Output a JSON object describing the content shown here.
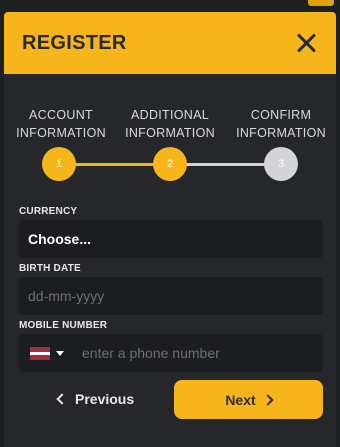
{
  "modal": {
    "title": "REGISTER",
    "close_icon": "close-icon"
  },
  "steps": [
    {
      "label_line1": "ACCOUNT",
      "label_line2": "INFORMATION",
      "number": "1",
      "state": "completed"
    },
    {
      "label_line1": "ADDITIONAL",
      "label_line2": "INFORMATION",
      "number": "2",
      "state": "current"
    },
    {
      "label_line1": "CONFIRM",
      "label_line2": "INFORMATION",
      "number": "3",
      "state": "upcoming"
    }
  ],
  "form": {
    "currency": {
      "label": "CURRENCY",
      "value": "Choose..."
    },
    "birth_date": {
      "label": "BIRTH DATE",
      "placeholder": "dd-mm-yyyy"
    },
    "mobile": {
      "label": "MOBILE NUMBER",
      "placeholder": "enter a phone number",
      "flag_icon": "latvia-flag-icon"
    }
  },
  "buttons": {
    "previous": "Previous",
    "next": "Next"
  },
  "colors": {
    "accent": "#f6b51b",
    "modal_bg": "#25272b",
    "field_bg": "#1c1d20",
    "step_inactive": "#d3d4d8",
    "flag_red": "#9e3039",
    "flag_white": "#ffffff"
  }
}
